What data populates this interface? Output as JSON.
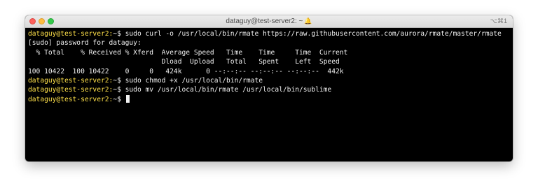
{
  "window": {
    "title": "dataguy@test-server2: ~",
    "shortcut": "⌥⌘1"
  },
  "terminal": {
    "prompt": "dataguy@test-server2:",
    "path": "~$",
    "commands": [
      " sudo curl -o /usr/local/bin/rmate https://raw.githubusercontent.com/aurora/rmate/master/rmate",
      " sudo chmod +x /usr/local/bin/rmate",
      " sudo mv /usr/local/bin/rmate /usr/local/bin/sublime"
    ],
    "output": [
      "[sudo] password for dataguy:",
      "  % Total    % Received % Xferd  Average Speed   Time    Time     Time  Current",
      "                                 Dload  Upload   Total   Spent    Left  Speed",
      "100 10422  100 10422    0     0   424k      0 --:--:-- --:--:-- --:--:--  442k"
    ]
  },
  "colors": {
    "terminal_background": "#000000",
    "prompt": "#ffe14a",
    "text": "#f2f2f2"
  }
}
